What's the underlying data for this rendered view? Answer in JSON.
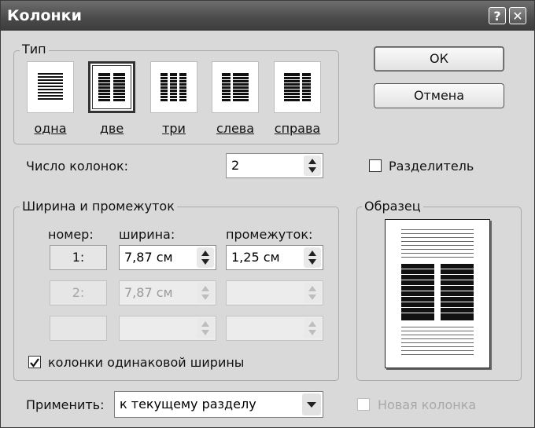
{
  "window": {
    "title": "Колонки",
    "help_label": "?",
    "close_label": "✕"
  },
  "type_group": {
    "legend": "Тип",
    "presets": [
      {
        "label": "одна"
      },
      {
        "label": "две"
      },
      {
        "label": "три"
      },
      {
        "label": "слева"
      },
      {
        "label": "справа"
      }
    ],
    "selected": "две"
  },
  "buttons": {
    "ok": "ОК",
    "cancel": "Отмена"
  },
  "num_columns": {
    "label": "Число колонок:",
    "value": "2"
  },
  "separator": {
    "label": "Разделитель",
    "checked": false
  },
  "width_group": {
    "legend": "Ширина и промежуток",
    "headers": {
      "number": "номер:",
      "width": "ширина:",
      "spacing": "промежуток:"
    },
    "rows": [
      {
        "number": "1:",
        "width": "7,87 см",
        "spacing": "1,25 см"
      },
      {
        "number": "2:",
        "width": "7,87 см",
        "spacing": ""
      },
      {
        "number": "",
        "width": "",
        "spacing": ""
      }
    ],
    "equal_width": {
      "label": "колонки одинаковой ширины",
      "checked": true
    }
  },
  "sample_group": {
    "legend": "Образец"
  },
  "apply": {
    "label": "Применить:",
    "value": "к текущему разделу"
  },
  "new_column": {
    "label": "Новая колонка",
    "checked": false
  }
}
